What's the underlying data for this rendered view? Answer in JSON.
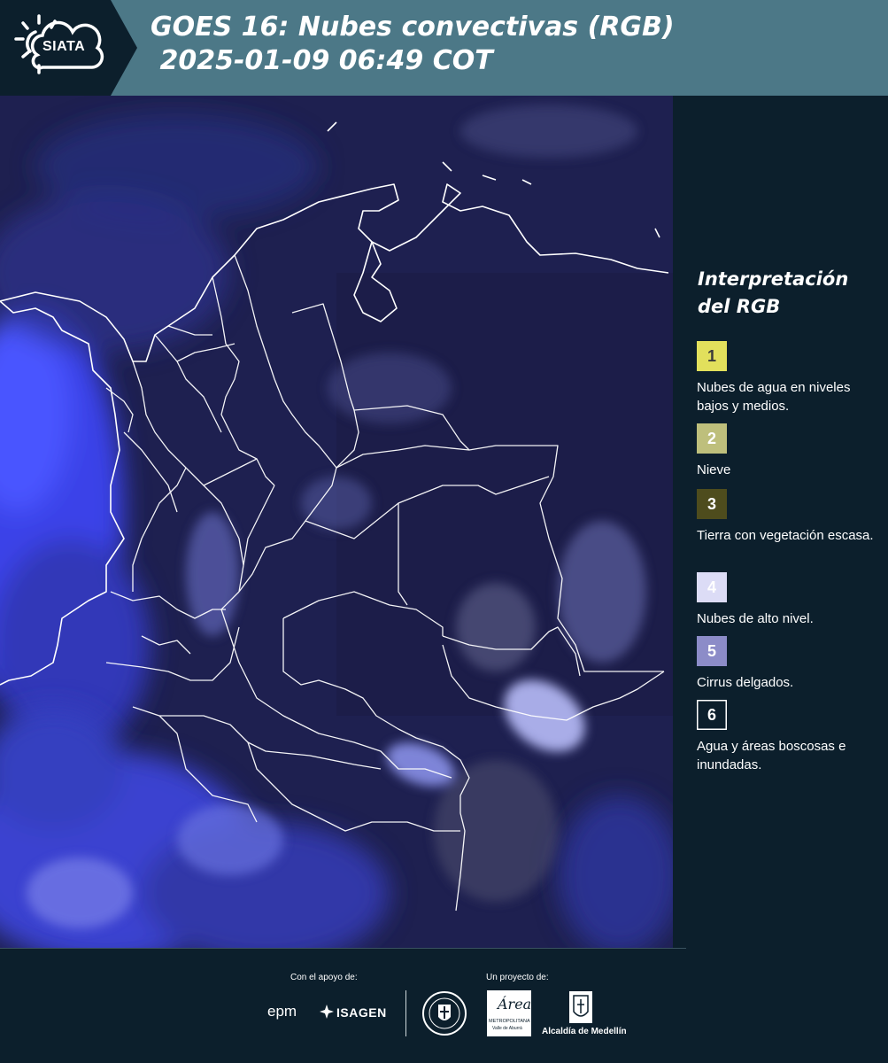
{
  "header": {
    "logo_text": "SIATA",
    "title_line1": "GOES 16: Nubes convectivas (RGB)",
    "title_line2": " 2025-01-09 06:49 COT"
  },
  "legend": {
    "title": "Interpretación del RGB",
    "items": [
      {
        "number": "1",
        "label": "Nubes de agua en niveles bajos y medios.",
        "color": "#e2e05c",
        "text_color": "#3b3b3b"
      },
      {
        "number": "2",
        "label": "Nieve",
        "color": "#bebf7c",
        "text_color": "#ffffff"
      },
      {
        "number": "3",
        "label": "Tierra con vegetación escasa.",
        "color": "#4e4c1d",
        "text_color": "#ffffff"
      },
      {
        "number": "4",
        "label": "Nubes de alto nivel.",
        "color": "#dcdcf6",
        "text_color": "#ffffff"
      },
      {
        "number": "5",
        "label": "Cirrus delgados.",
        "color": "#8c8cc8",
        "text_color": "#ffffff"
      },
      {
        "number": "6",
        "label": "Agua y áreas boscosas e inundadas.",
        "color": "#0c1f2c",
        "text_color": "#ffffff"
      }
    ]
  },
  "footer": {
    "support_label": "Con el apoyo de:",
    "project_label": "Un proyecto de:",
    "epm": "epm",
    "isagen": "ISAGEN",
    "area_script": "Área",
    "area_line1": "METROPOLITANA",
    "area_line2": "Valle de Aburrá",
    "alcaldia": "Alcaldía de Medellín"
  },
  "colors": {
    "header_bg": "#4c7887",
    "panel_bg": "#0c1f2c",
    "map_bg": "#1d1f4c",
    "cloud_blue": "#3a43e0"
  }
}
